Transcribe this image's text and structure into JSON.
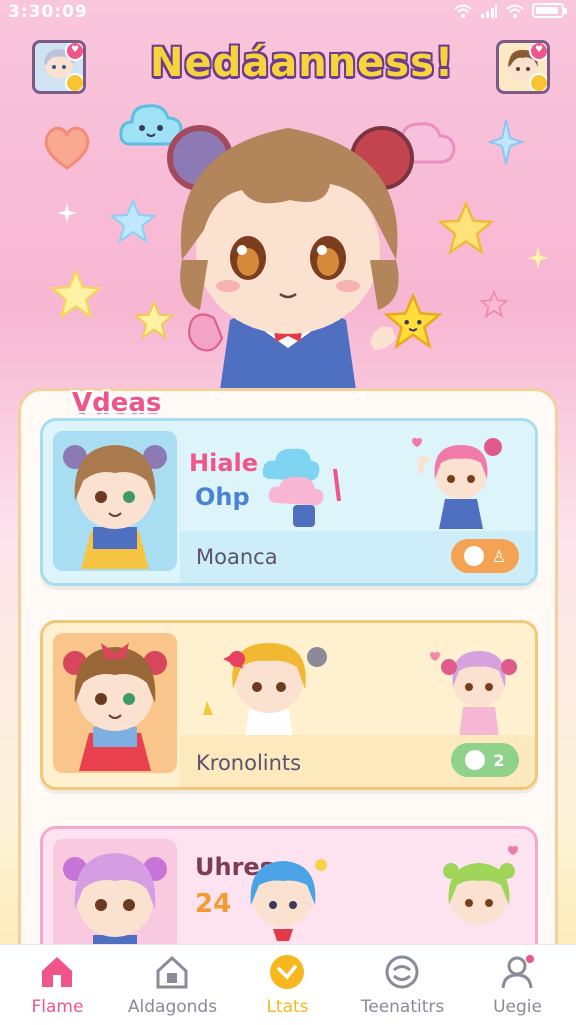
{
  "status_bar": {
    "time": "3:30:09"
  },
  "app": {
    "title": "Nedáanness!"
  },
  "section": {
    "label": "Vdeas"
  },
  "items": [
    {
      "heading_line1": "Hiale",
      "heading_line2": "Ohp",
      "name": "Moanca",
      "badge": "",
      "theme": "#cfeefb"
    },
    {
      "heading_line1": "",
      "heading_line2": "",
      "name": "Kronolints",
      "badge": "2",
      "theme": "#fff1cf"
    },
    {
      "heading_line1": "Uhres",
      "heading_line2": "24",
      "name": "",
      "badge": "",
      "theme": "#fde3f0"
    }
  ],
  "tabs": [
    {
      "label": "Flame",
      "icon": "home-icon",
      "active": true
    },
    {
      "label": "Aldagonds",
      "icon": "house-icon",
      "active": false
    },
    {
      "label": "Ltats",
      "icon": "heart-badge-icon",
      "active": false
    },
    {
      "label": "Teenatitrs",
      "icon": "refresh-icon",
      "active": false
    },
    {
      "label": "Uegie",
      "icon": "profile-icon",
      "active": false
    }
  ],
  "colors": {
    "accent_pink": "#f0558a",
    "title_yellow": "#f8d43c",
    "title_outline": "#6b3b8f",
    "tab_active": "#f0558a",
    "tab_gold": "#f6b81e"
  }
}
